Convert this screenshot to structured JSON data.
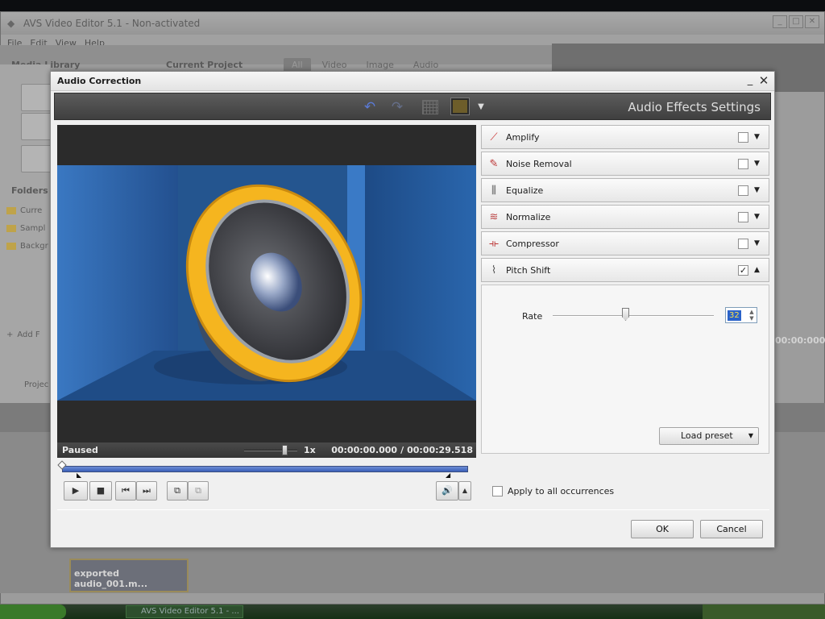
{
  "background_app": {
    "title": "AVS Video Editor 5.1 - Non-activated",
    "menu": [
      "File",
      "Edit",
      "View",
      "Help"
    ],
    "media_library_label": "Media Library",
    "current_project_label": "Current Project",
    "filters": [
      "All",
      "Video",
      "Image",
      "Audio"
    ],
    "folders_label": "Folders",
    "folders": [
      "Curre",
      "Sampl",
      "Backgr"
    ],
    "add_folder": "Add F",
    "project_label": "Projec",
    "clip_label": "exported audio_001.m...",
    "timecode": "00:00:000",
    "taskbar_item": "AVS Video Editor 5.1 - ..."
  },
  "dialog": {
    "title": "Audio Correction",
    "toolbar_title": "Audio Effects Settings",
    "minimize_glyph": "_",
    "close_glyph": "✕",
    "preview": {
      "status": "Paused",
      "speed": "1x",
      "speed_level": 0.75,
      "current_time": "00:00:00.000",
      "time_separator": "/",
      "total_time": "00:00:29.518"
    },
    "controls": {
      "play": "▶",
      "stop": "■",
      "prev": "⏮",
      "next": "⏭",
      "mark_in": "⧉",
      "mark_out": "⧉",
      "volume": "🔊",
      "volume_arrow": "▲"
    },
    "effects": [
      {
        "label": "Amplify",
        "icon": "amplify-icon",
        "glyph": "⟋",
        "checked": false,
        "expand": "▼"
      },
      {
        "label": "Noise Removal",
        "icon": "noise-removal-icon",
        "glyph": "✎",
        "checked": false,
        "expand": "▼"
      },
      {
        "label": "Equalize",
        "icon": "equalize-icon",
        "glyph": "⫼",
        "checked": false,
        "expand": "▼"
      },
      {
        "label": "Normalize",
        "icon": "normalize-icon",
        "glyph": "≋",
        "checked": false,
        "expand": "▼"
      },
      {
        "label": "Compressor",
        "icon": "compressor-icon",
        "glyph": "⟛",
        "checked": false,
        "expand": "▼"
      },
      {
        "label": "Pitch Shift",
        "icon": "pitch-shift-icon",
        "glyph": "⌇",
        "checked": true,
        "check_glyph": "✓",
        "expand": "▲"
      }
    ],
    "pitch_shift": {
      "rate_label": "Rate",
      "rate_value": "32",
      "rate_level": 0.45,
      "load_preset": "Load preset",
      "load_preset_arrow": "▼"
    },
    "apply_all": "Apply to all occurrences",
    "ok": "OK",
    "cancel": "Cancel"
  },
  "colors": {
    "toolbar_bg": "#4a4a4a",
    "seek_blue": "#4a6fc8",
    "speaker_yellow": "#f5b51f",
    "scene_blue": "#2f5f9a"
  }
}
